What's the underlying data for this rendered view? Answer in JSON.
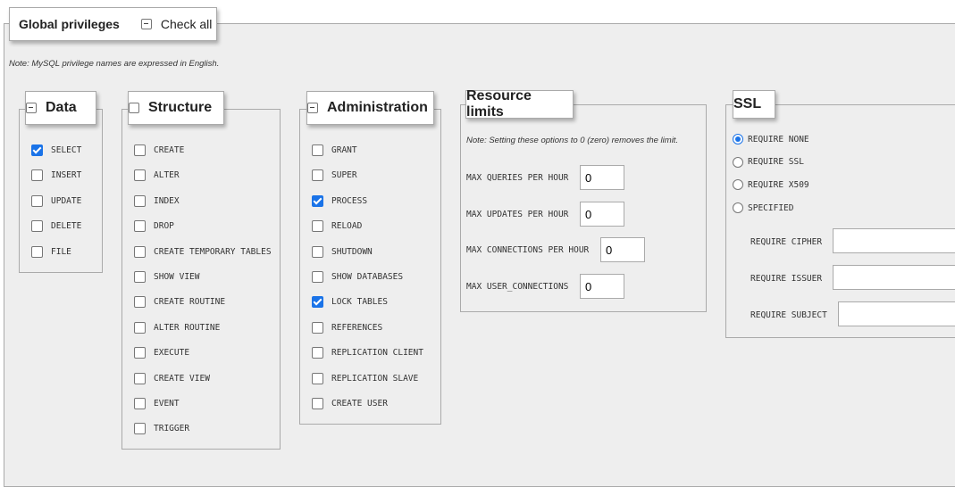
{
  "header": {
    "title": "Global privileges",
    "check_all": "Check all"
  },
  "note": "Note: MySQL privilege names are expressed in English.",
  "data": {
    "title": "Data",
    "items": [
      {
        "label": "SELECT",
        "checked": true
      },
      {
        "label": "INSERT",
        "checked": false
      },
      {
        "label": "UPDATE",
        "checked": false
      },
      {
        "label": "DELETE",
        "checked": false
      },
      {
        "label": "FILE",
        "checked": false
      }
    ]
  },
  "structure": {
    "title": "Structure",
    "items": [
      {
        "label": "CREATE",
        "checked": false
      },
      {
        "label": "ALTER",
        "checked": false
      },
      {
        "label": "INDEX",
        "checked": false
      },
      {
        "label": "DROP",
        "checked": false
      },
      {
        "label": "CREATE TEMPORARY TABLES",
        "checked": false
      },
      {
        "label": "SHOW VIEW",
        "checked": false
      },
      {
        "label": "CREATE ROUTINE",
        "checked": false
      },
      {
        "label": "ALTER ROUTINE",
        "checked": false
      },
      {
        "label": "EXECUTE",
        "checked": false
      },
      {
        "label": "CREATE VIEW",
        "checked": false
      },
      {
        "label": "EVENT",
        "checked": false
      },
      {
        "label": "TRIGGER",
        "checked": false
      }
    ]
  },
  "administration": {
    "title": "Administration",
    "items": [
      {
        "label": "GRANT",
        "checked": false
      },
      {
        "label": "SUPER",
        "checked": false
      },
      {
        "label": "PROCESS",
        "checked": true
      },
      {
        "label": "RELOAD",
        "checked": false
      },
      {
        "label": "SHUTDOWN",
        "checked": false
      },
      {
        "label": "SHOW DATABASES",
        "checked": false
      },
      {
        "label": "LOCK TABLES",
        "checked": true
      },
      {
        "label": "REFERENCES",
        "checked": false
      },
      {
        "label": "REPLICATION CLIENT",
        "checked": false
      },
      {
        "label": "REPLICATION SLAVE",
        "checked": false
      },
      {
        "label": "CREATE USER",
        "checked": false
      }
    ]
  },
  "resource": {
    "title": "Resource limits",
    "note": "Note: Setting these options to 0 (zero) removes the limit.",
    "fields": [
      {
        "label": "MAX QUERIES PER HOUR",
        "value": "0"
      },
      {
        "label": "MAX UPDATES PER HOUR",
        "value": "0"
      },
      {
        "label": "MAX CONNECTIONS PER HOUR",
        "value": "0"
      },
      {
        "label": "MAX USER_CONNECTIONS",
        "value": "0"
      }
    ]
  },
  "ssl": {
    "title": "SSL",
    "options": [
      {
        "label": "REQUIRE NONE",
        "selected": true
      },
      {
        "label": "REQUIRE SSL",
        "selected": false
      },
      {
        "label": "REQUIRE X509",
        "selected": false
      },
      {
        "label": "SPECIFIED",
        "selected": false
      }
    ],
    "fields": [
      {
        "label": "REQUIRE CIPHER",
        "value": ""
      },
      {
        "label": "REQUIRE ISSUER",
        "value": ""
      },
      {
        "label": "REQUIRE SUBJECT",
        "value": ""
      }
    ]
  },
  "colors": {
    "accent": "#1a73e8",
    "panel_bg": "#eeeeee",
    "border": "#aaaaaa"
  }
}
